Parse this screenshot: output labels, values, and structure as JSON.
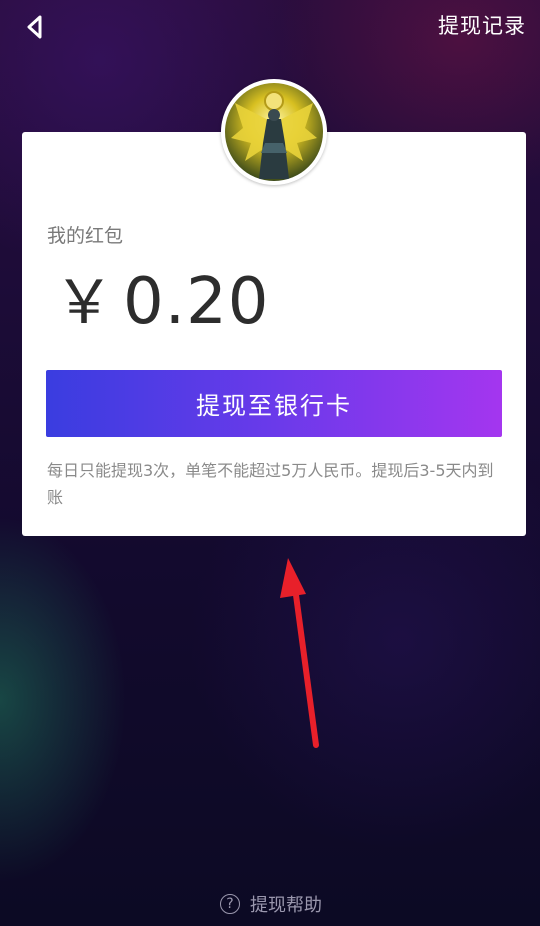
{
  "header": {
    "back_icon": "chevron-left-icon",
    "history_label": "提现记录"
  },
  "card": {
    "avatar_icon": "user-avatar-icon",
    "wallet_label": "我的红包",
    "currency_symbol": "￥",
    "balance_amount": "0.20",
    "withdraw_button_label": "提现至银行卡",
    "notice_text": "每日只能提现3次，单笔不能超过5万人民币。提现后3-5天内到账"
  },
  "footer": {
    "help_icon": "question-circle-icon",
    "help_label": "提现帮助"
  },
  "colors": {
    "button_gradient_start": "#3a3de0",
    "button_gradient_end": "#a436ef",
    "annotation_arrow": "#e8202a"
  }
}
